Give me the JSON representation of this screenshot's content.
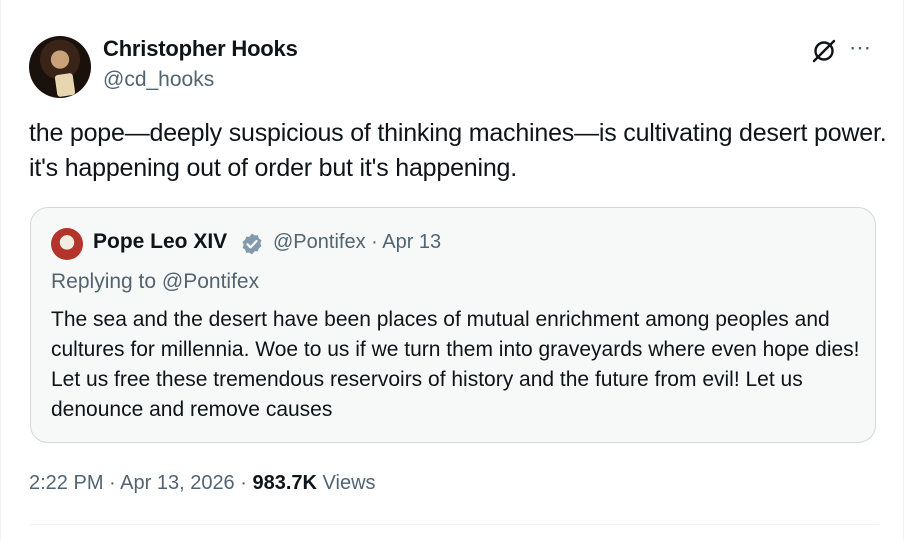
{
  "author": {
    "name": "Christopher Hooks",
    "handle": "@cd_hooks"
  },
  "icons": {
    "grok": "grok-icon",
    "more": "more-icon",
    "verified": "verified-badge-icon"
  },
  "tweet": {
    "text": "the pope—deeply suspicious of thinking machines—is cultivating desert power. it's happening out of order but it's happening."
  },
  "quote": {
    "name": "Pope Leo XIV",
    "handle_date": "@Pontifex · Apr 13",
    "replying": "Replying to @Pontifex",
    "text": "The sea and the desert have been places of mutual enrichment among peoples and cultures for millennia. Woe to us if we turn them into graveyards where even hope dies! Let us free these tremendous reservoirs of history and the future from evil! Let us denounce and remove causes"
  },
  "meta": {
    "time_date": "2:22 PM · Apr 13, 2026 · ",
    "views_count": "983.7K",
    "views_label": " Views"
  },
  "colors": {
    "text_primary": "#0f1419",
    "text_secondary": "#536471",
    "verified": "#829aab",
    "quote_bg": "#f7f9f9",
    "border": "#cfd9de"
  }
}
